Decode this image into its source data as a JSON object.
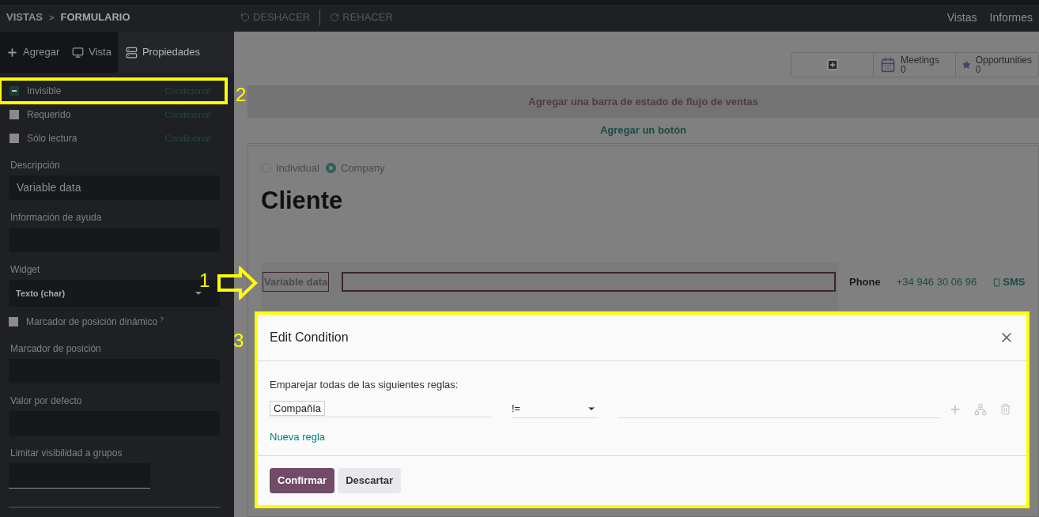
{
  "breadcrumb": {
    "root": "VISTAS",
    "separator": ">",
    "current": "FORMULARIO"
  },
  "toolbar": [
    {
      "kind": "undo",
      "label": "DESHACER"
    },
    {
      "kind": "redo",
      "label": "REHACER"
    }
  ],
  "top_menu": [
    "Vistas",
    "Informes"
  ],
  "sidebar": {
    "tabs": [
      {
        "label": "Agregar",
        "selected": false
      },
      {
        "label": "Vista",
        "selected": false
      },
      {
        "label": "Propiedades",
        "selected": true
      }
    ],
    "toggles": [
      {
        "label": "Invisible",
        "checked": true,
        "link": "Condicional"
      },
      {
        "label": "Requerido",
        "checked": false,
        "link": "Condicional"
      },
      {
        "label": "Sólo lectura",
        "checked": false,
        "link": "Condicional"
      }
    ],
    "fields": [
      {
        "kind": "input",
        "label": "Descripción",
        "value": "Variable data"
      },
      {
        "kind": "input",
        "label": "Información de ayuda"
      },
      {
        "kind": "select",
        "label": "Widget",
        "value": "Texto (char)"
      },
      {
        "kind": "checkbox",
        "label": "Marcador de posición dinámico",
        "checked": false,
        "hint": "?"
      },
      {
        "kind": "input",
        "label": "Marcador de posición"
      },
      {
        "kind": "input",
        "label": "Valor por defecto"
      },
      {
        "kind": "narrow",
        "label": "Limitar visibilidad a grupos"
      }
    ]
  },
  "form": {
    "smart_buttons": [
      {
        "kind": "add"
      },
      {
        "kind": "calendar",
        "label": "Meetings",
        "count": "0"
      },
      {
        "kind": "star",
        "label": "Opportunities",
        "count": "0"
      }
    ],
    "status_bar": "Agregar una barra de estado de flujo de ventas",
    "add_button": "Agregar un botón",
    "radios": [
      {
        "label": "Individual",
        "selected": false
      },
      {
        "label": "Company",
        "selected": true
      }
    ],
    "title": "Cliente",
    "field_label": "Variable data",
    "phone_label": "Phone",
    "phone": "+34 946 30 06 96",
    "sms": "SMS"
  },
  "dialog": {
    "title": "Edit Condition",
    "intro": "Emparejar todas de las siguientes reglas:",
    "rule": {
      "field": "Compañía",
      "operator": "!="
    },
    "new_rule": "Nueva regla",
    "buttons": [
      {
        "kind": "primary",
        "label": "Confirmar"
      },
      {
        "kind": "secondary",
        "label": "Descartar"
      }
    ]
  },
  "annotations": [
    "1",
    "2",
    "3"
  ]
}
